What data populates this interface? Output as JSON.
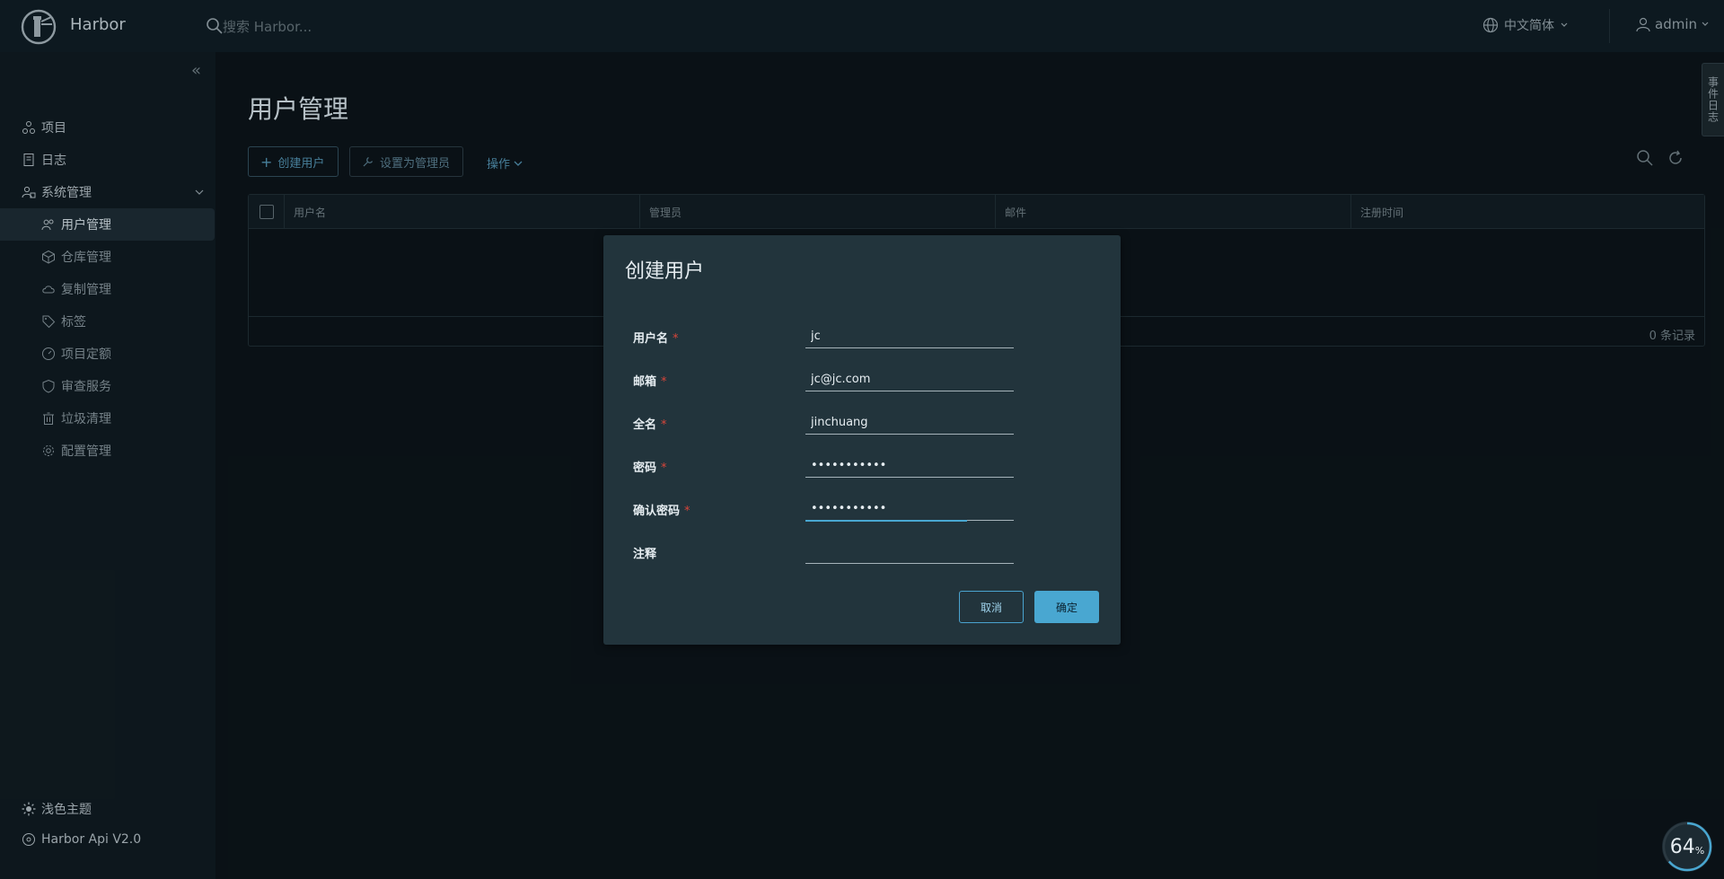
{
  "header": {
    "brand": "Harbor",
    "search_placeholder": "搜索 Harbor...",
    "language": "中文简体",
    "user": "admin"
  },
  "sidebar": {
    "items": [
      {
        "label": "项目"
      },
      {
        "label": "日志"
      },
      {
        "label": "系统管理"
      }
    ],
    "sub_items": [
      {
        "label": "用户管理"
      },
      {
        "label": "仓库管理"
      },
      {
        "label": "复制管理"
      },
      {
        "label": "标签"
      },
      {
        "label": "项目定额"
      },
      {
        "label": "审查服务"
      },
      {
        "label": "垃圾清理"
      },
      {
        "label": "配置管理"
      }
    ],
    "footer": {
      "theme": "浅色主题",
      "api": "Harbor Api V2.0"
    }
  },
  "main": {
    "title": "用户管理",
    "toolbar": {
      "create": "创建用户",
      "set_admin": "设置为管理员",
      "ops": "操作"
    },
    "grid": {
      "columns": [
        "用户名",
        "管理员",
        "邮件",
        "注册时间"
      ],
      "records": "0 条记录"
    }
  },
  "side_tab": "事件日志",
  "modal": {
    "title": "创建用户",
    "fields": [
      {
        "label": "用户名",
        "required": "*",
        "value": "jc"
      },
      {
        "label": "邮箱",
        "required": "*",
        "value": "jc@jc.com"
      },
      {
        "label": "全名",
        "required": "*",
        "value": "jinchuang"
      },
      {
        "label": "密码",
        "required": "*",
        "value": "•••••••••••"
      },
      {
        "label": "确认密码",
        "required": "*",
        "value": "•••••••••••"
      },
      {
        "label": "注释",
        "required": "",
        "value": ""
      }
    ],
    "cancel": "取消",
    "ok": "确定"
  },
  "badge": {
    "value": "64",
    "unit": "%"
  }
}
